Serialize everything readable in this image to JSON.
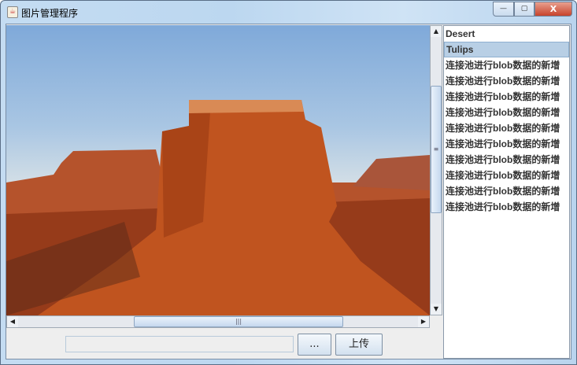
{
  "window": {
    "title": "图片管理程序",
    "minimize": "—",
    "maximize": "▢",
    "close": "X"
  },
  "image": {
    "name": "Desert"
  },
  "list": {
    "items": [
      "Desert",
      "Tulips",
      "连接池进行blob数据的新增",
      "连接池进行blob数据的新增",
      "连接池进行blob数据的新增",
      "连接池进行blob数据的新增",
      "连接池进行blob数据的新增",
      "连接池进行blob数据的新增",
      "连接池进行blob数据的新增",
      "连接池进行blob数据的新增",
      "连接池进行blob数据的新增",
      "连接池进行blob数据的新增"
    ],
    "selected_index": 1
  },
  "file_field": {
    "value": ""
  },
  "buttons": {
    "browse": "...",
    "upload": "上传"
  },
  "scroll": {
    "up": "▲",
    "down": "▼",
    "left": "◀",
    "right": "▶",
    "grip_v": "≡",
    "grip_h": "|||"
  }
}
